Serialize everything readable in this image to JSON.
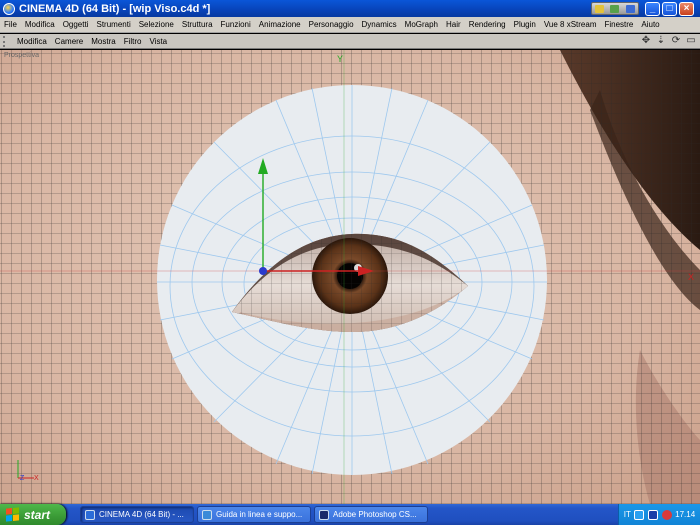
{
  "window": {
    "title": "CINEMA 4D (64 Bit) - [wip Viso.c4d *]",
    "controls": {
      "minimize": "_",
      "maximize": "□",
      "close": "×"
    }
  },
  "menu": [
    "File",
    "Modifica",
    "Oggetti",
    "Strumenti",
    "Selezione",
    "Struttura",
    "Funzioni",
    "Animazione",
    "Personaggio",
    "Dynamics",
    "MoGraph",
    "Hair",
    "Rendering",
    "Plugin",
    "Vue 8 xStream",
    "Finestre",
    "Aiuto"
  ],
  "viewport_menu": [
    "Modifica",
    "Camere",
    "Mostra",
    "Filtro",
    "Vista"
  ],
  "viewport": {
    "label": "Prospettiva",
    "axis_y_label": "Y",
    "axis_x_label": "X",
    "axis_z_label": "Z",
    "nav_icons": [
      "move-icon",
      "zoom-icon",
      "rotate-icon",
      "maximize-view-icon"
    ]
  },
  "taskbar": {
    "start_label": "start",
    "tasks": [
      {
        "label": "CINEMA 4D (64 Bit) - ...",
        "icon": "cinema4d-icon",
        "active": true
      },
      {
        "label": "Guida in linea e suppo...",
        "icon": "help-icon",
        "active": false
      },
      {
        "label": "Adobe Photoshop CS...",
        "icon": "photoshop-icon",
        "active": false
      }
    ],
    "tray": {
      "language": "IT",
      "clock": "17.14"
    }
  },
  "colors": {
    "titlebar": "#0843b8",
    "grid_line": "#2a2a2a",
    "mesh_fill": "#e8ecf0",
    "mesh_line": "#9ec8ee",
    "axis_y": "#22aa22",
    "axis_x": "#cc2222"
  }
}
